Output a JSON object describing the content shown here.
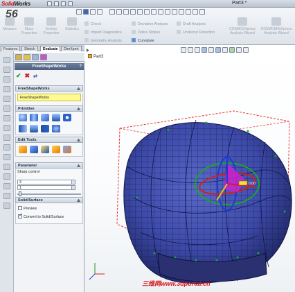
{
  "window": {
    "app_name_part1": "Solid",
    "app_name_part2": "Works",
    "document_title": "Part3 *",
    "logo_overlay": "56"
  },
  "ribbon": {
    "big_buttons": [
      {
        "label": "Measure"
      },
      {
        "label": "Mass Properties"
      },
      {
        "label": "Section Properties"
      },
      {
        "label": "Statistics"
      }
    ],
    "col1": [
      "Check",
      "Import Diagnostics",
      "Geometry Analysis"
    ],
    "col2": [
      "Deviation Analysis",
      "Zebra Stripes",
      "Curvature"
    ],
    "col3": [
      "Draft Analysis",
      "Undercut Detection"
    ],
    "big_right": [
      {
        "label": "COSMOSXpress Analysis Wizard"
      },
      {
        "label": "COSMOSFloXpress Analysis Wizard"
      }
    ]
  },
  "command_tabs": [
    "Features",
    "Sketch",
    "Evaluate",
    "DimXpert"
  ],
  "active_command_tab": "Evaluate",
  "panel": {
    "title": "FreeShapeWorks",
    "help": "?",
    "ok_glyph": "✔",
    "cancel_glyph": "✖",
    "pin_glyph": "⇄",
    "groups": {
      "freeshape": {
        "title": "FreeShapeWorks",
        "item": "FreeShapeWorks"
      },
      "primitive": {
        "title": "Primitive"
      },
      "edit_tools": {
        "title": "Edit Tools"
      },
      "parameter": {
        "title": "Parameter",
        "sharp_label": "Sharp control",
        "value1": "3",
        "value2": "1"
      },
      "solid_surface": {
        "title": "Solid/Surface",
        "preview_label": "Preview",
        "preview_checked": false,
        "convert_label": "Convert to Solid/Surface",
        "convert_checked": true
      }
    }
  },
  "viewport": {
    "tree_item": "Part3",
    "watermark": "三维网www.3dportal.cn"
  },
  "colors": {
    "accent": "#4c5f7e",
    "mesh_fill": "#3d4aa8",
    "mesh_line": "#1a1f55",
    "selection": "#cc22cc",
    "bbox": "#e83030",
    "handle_green": "#1aa52a",
    "watermark_red": "#d4171d"
  }
}
